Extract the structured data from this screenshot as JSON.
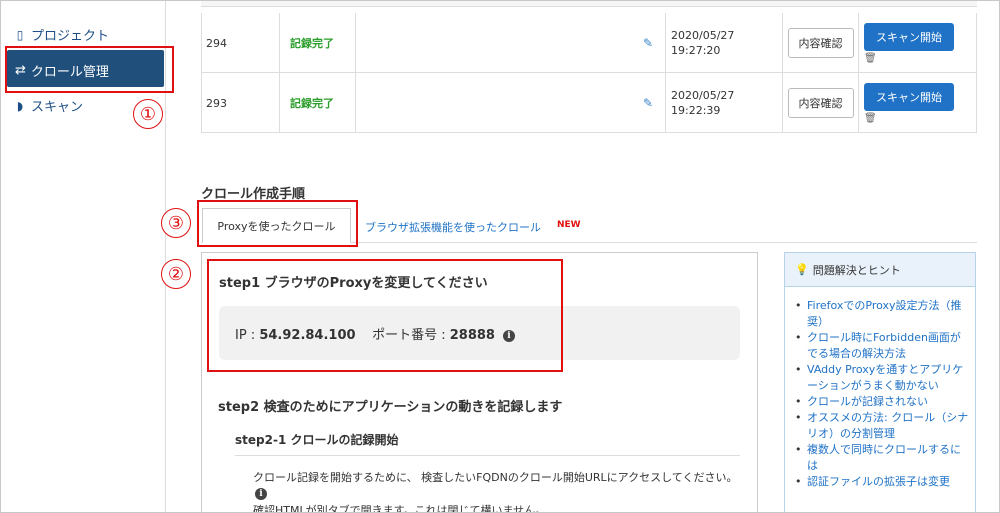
{
  "sidebar": {
    "items": [
      {
        "label": "プロジェクト",
        "icon": "document-icon"
      },
      {
        "label": "クロール管理",
        "icon": "arrows-icon"
      },
      {
        "label": "スキャン",
        "icon": "shield-icon"
      }
    ]
  },
  "annotations": [
    "①",
    "②",
    "③"
  ],
  "table": {
    "rows": [
      {
        "id": "294",
        "status": "記録完了",
        "date": "2020/05/27",
        "time": "19:27:20",
        "confirm_label": "内容確認",
        "scan_label": "スキャン開始"
      },
      {
        "id": "293",
        "status": "記録完了",
        "date": "2020/05/27",
        "time": "19:22:39",
        "confirm_label": "内容確認",
        "scan_label": "スキャン開始"
      }
    ]
  },
  "section": {
    "title": "クロール作成手順",
    "tabs": [
      {
        "label": "Proxyを使ったクロール",
        "active": true
      },
      {
        "label": "ブラウザ拡張機能を使ったクロール",
        "badge": "NEW",
        "active": false
      }
    ]
  },
  "main": {
    "step1_title": "step1 ブラウザのProxyを変更してください",
    "ip_label": "IP : ",
    "ip_value": "54.92.84.100",
    "port_label": "ポート番号 : ",
    "port_value": "28888",
    "step2_title": "step2 検査のためにアプリケーションの動きを記録します",
    "step21_title": "step2-1 クロールの記録開始",
    "body_text": "クロール記録を開始するために、 検査したいFQDNのクロール開始URLにアクセスしてください。",
    "body_text2": "確認HTMLが別タブで開きます。これは閉じて構いません。"
  },
  "hints": {
    "title": "問題解決とヒント",
    "items": [
      "FirefoxでのProxy設定方法（推奨）",
      "クロール時にForbidden画面がでる場合の解決方法",
      "VAddy Proxyを通すとアプリケーションがうまく動かない",
      "クロールが記録されない",
      "オススメの方法: クロール（シナリオ）の分割管理",
      "複数人で同時にクロールするには",
      "認証ファイルの拡張子は変更"
    ]
  },
  "colors": {
    "accent": "#1f72c6",
    "sidebar_active": "#1f4f7a",
    "highlight": "#e01010",
    "success": "#2a9d2a"
  }
}
